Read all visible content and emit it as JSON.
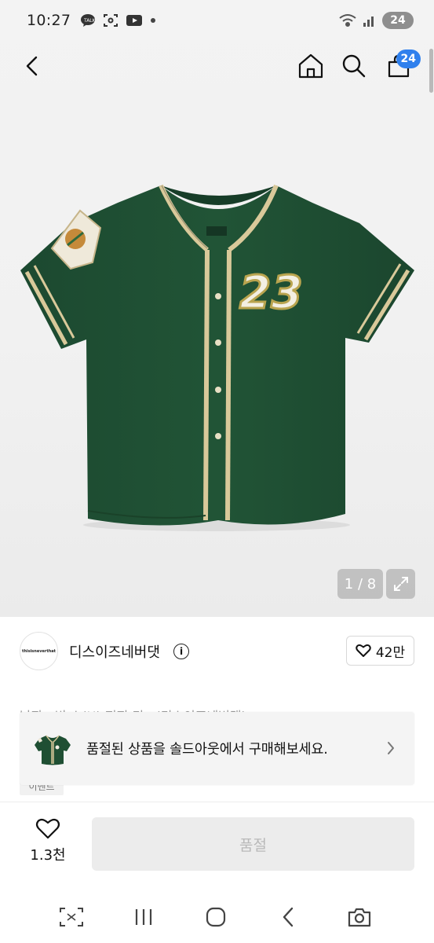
{
  "status_bar": {
    "time": "10:27",
    "battery": "24",
    "left_icons": [
      "chat-bubble-icon",
      "talk-icon",
      "screenshot-icon",
      "youtube-icon",
      "dot-icon"
    ],
    "right_icons": [
      "wifi-icon",
      "signal-icon"
    ]
  },
  "header": {
    "back_icon": "back-arrow-icon",
    "home_icon": "home-icon",
    "search_icon": "search-icon",
    "cart_icon": "shopping-bag-icon",
    "cart_count": "24"
  },
  "gallery": {
    "counter": "1 / 8",
    "expand_icon": "expand-icon",
    "jersey_number": "23",
    "colors": {
      "jersey": "#1f4f33",
      "piping": "#d9c99a",
      "background": "#f2f2f2"
    }
  },
  "brand": {
    "name": "디스이즈네버댓",
    "info_symbol": "i",
    "logo_text": "thisisneverthat",
    "like_count": "42만"
  },
  "product": {
    "title_peek": "남자 · 빈 스(H) 저지 티 · (디스이즈네버댓)",
    "tag_peek": "이벤트"
  },
  "soldout_banner": {
    "text": "품절된 상품을 솔드아웃에서 구매해보세요."
  },
  "action_bar": {
    "wish_count": "1.3천",
    "buy_label": "품절"
  },
  "nav": {
    "icons": [
      "quick-capture-icon",
      "recents-icon",
      "home-circle-icon",
      "back-chevron-icon",
      "camera-icon"
    ]
  },
  "accent_color": "#2f80ed"
}
